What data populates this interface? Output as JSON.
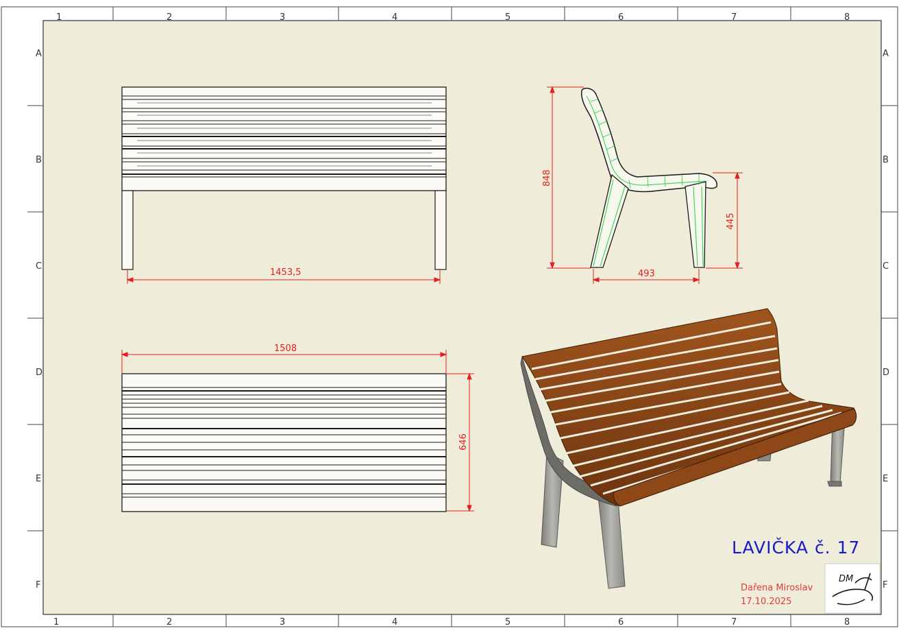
{
  "sheet": {
    "column_labels": [
      "1",
      "2",
      "3",
      "4",
      "5",
      "6",
      "7",
      "8"
    ],
    "row_labels": [
      "A",
      "B",
      "C",
      "D",
      "E",
      "F"
    ]
  },
  "dimensions": {
    "front_width": "1453,5",
    "top_length": "1508",
    "top_depth": "646",
    "side_height": "848",
    "side_seat_height": "445",
    "side_depth": "493"
  },
  "title_block": {
    "title": "LAVIČKA č. 17",
    "author": "Dařena Miroslav",
    "date": "17.10.2025",
    "logo_text": "DM"
  },
  "colors": {
    "paper": "#efedd9",
    "dimension": "#e02020",
    "title": "#1a1acc",
    "wood": "#8a4516",
    "frame": "#9a9a94"
  }
}
